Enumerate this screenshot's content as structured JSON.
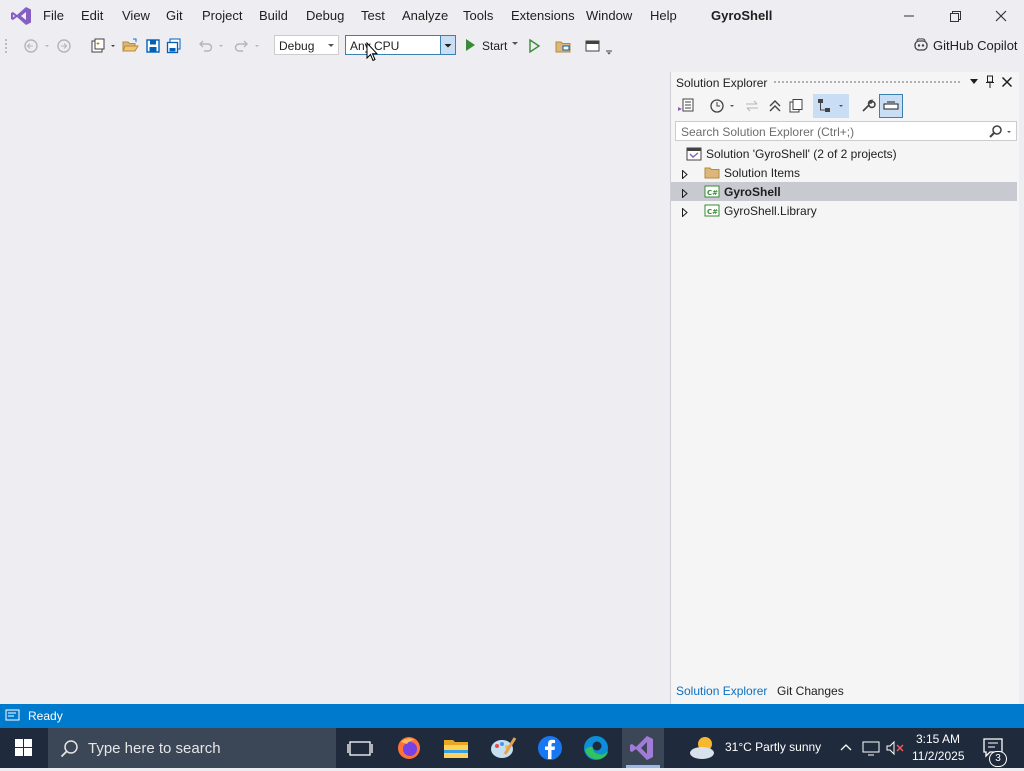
{
  "menu": {
    "items": [
      "File",
      "Edit",
      "View",
      "Git",
      "Project",
      "Build",
      "Debug",
      "Test",
      "Analyze",
      "Tools",
      "Extensions",
      "Window",
      "Help"
    ],
    "solution_name": "GyroShell"
  },
  "toolbar": {
    "configuration": "Debug",
    "platform": "Any CPU",
    "start_label": "Start",
    "copilot_label": "GitHub Copilot"
  },
  "solution_explorer": {
    "title": "Solution Explorer",
    "search_placeholder": "Search Solution Explorer (Ctrl+;)",
    "root": "Solution 'GyroShell' (2 of 2 projects)",
    "items": [
      {
        "label": "Solution Items",
        "type": "folder"
      },
      {
        "label": "GyroShell",
        "type": "project",
        "selected": true
      },
      {
        "label": "GyroShell.Library",
        "type": "project"
      }
    ],
    "tabs": [
      "Solution Explorer",
      "Git Changes"
    ]
  },
  "status": {
    "text": "Ready"
  },
  "taskbar": {
    "search_placeholder": "Type here to search",
    "weather": "31°C  Partly sunny",
    "time": "3:15 AM",
    "date": "11/2/2025",
    "notification_count": "3"
  },
  "colors": {
    "accent": "#007acc",
    "vs_purple": "#865fc5",
    "selection": "#c9c9d1"
  }
}
